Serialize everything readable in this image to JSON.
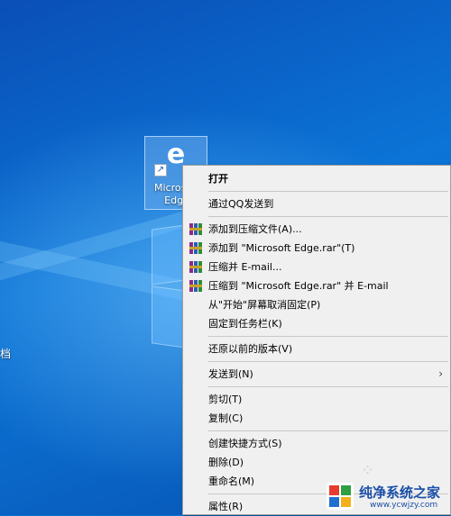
{
  "desktop": {
    "icon_label": "Microsoft Edge",
    "left_label": "档"
  },
  "context_menu": {
    "items": [
      {
        "label": "打开"
      },
      {
        "label": "通过QQ发送到"
      },
      {
        "label": "添加到压缩文件(A)..."
      },
      {
        "label": "添加到 \"Microsoft Edge.rar\"(T)"
      },
      {
        "label": "压缩并 E-mail..."
      },
      {
        "label": "压缩到 \"Microsoft Edge.rar\" 并 E-mail"
      },
      {
        "label": "从\"开始\"屏幕取消固定(P)"
      },
      {
        "label": "固定到任务栏(K)"
      },
      {
        "label": "还原以前的版本(V)"
      },
      {
        "label": "发送到(N)"
      },
      {
        "label": "剪切(T)"
      },
      {
        "label": "复制(C)"
      },
      {
        "label": "创建快捷方式(S)"
      },
      {
        "label": "删除(D)"
      },
      {
        "label": "重命名(M)"
      },
      {
        "label": "属性(R)"
      }
    ],
    "submenu_arrow": "›"
  },
  "watermark": {
    "title": "纯净系统之家",
    "url": "www.ycwjzy.com"
  },
  "icons": {
    "edge": "edge-logo-icon",
    "shortcut": "shortcut-arrow-icon",
    "rar": "winrar-icon"
  }
}
